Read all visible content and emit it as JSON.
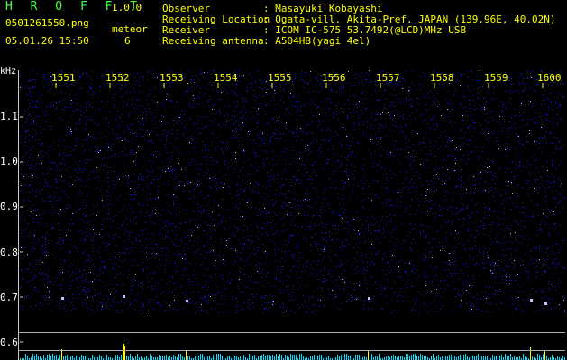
{
  "header": {
    "app_title": "H R O F F T",
    "app_version": "1.0.0",
    "file_name": "0501261550.png",
    "timestamp": "05.01.26 15:50",
    "meteor_label": "meteor",
    "meteor_count": "6"
  },
  "info": [
    {
      "label": "Observer",
      "value": ": Masayuki Kobayashi"
    },
    {
      "label": "Receiving Location",
      "value": ": Ogata-vill. Akita-Pref. JAPAN (139.96E, 40.02N)"
    },
    {
      "label": "Receiver",
      "value": ": ICOM IC-575 53.7492(@LCD)MHz USB"
    },
    {
      "label": "Receiving antenna",
      "value": ": A504HB(yagi 4el)"
    }
  ],
  "spectrogram": {
    "y_unit": "kHz",
    "x_ticks": [
      "1551",
      "1552",
      "1553",
      "1554",
      "1555",
      "1556",
      "1557",
      "1558",
      "1559",
      "1600"
    ],
    "y_ticks": [
      "1.1",
      "1.0",
      "0.9",
      "0.8",
      "0.7",
      "0.6"
    ],
    "colors": {
      "background": "#000000",
      "noise": "#1a1aff",
      "signal": "#ffff00",
      "tick": "#ffff00",
      "spectrum": "#00e0ff"
    }
  }
}
